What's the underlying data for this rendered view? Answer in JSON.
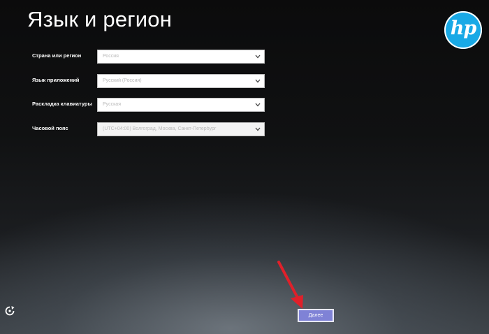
{
  "header": {
    "title": "Язык и регион",
    "logo_text": "hp"
  },
  "form": {
    "fields": [
      {
        "label": "Страна или регион",
        "value": "Россия"
      },
      {
        "label": "Язык приложений",
        "value": "Русский (Россия)"
      },
      {
        "label": "Раскладка клавиатуры",
        "value": "Русская"
      },
      {
        "label": "Часовой пояс",
        "value": "(UTC+04:00) Волгоград, Москва, Санкт-Петербург"
      }
    ]
  },
  "footer": {
    "next_label": "Далее",
    "ease_of_access_icon": "ease-of-access-icon"
  },
  "colors": {
    "hp_blue": "#18a9e6",
    "next_button": "#7f82d6",
    "annotation_arrow": "#e0202a"
  }
}
